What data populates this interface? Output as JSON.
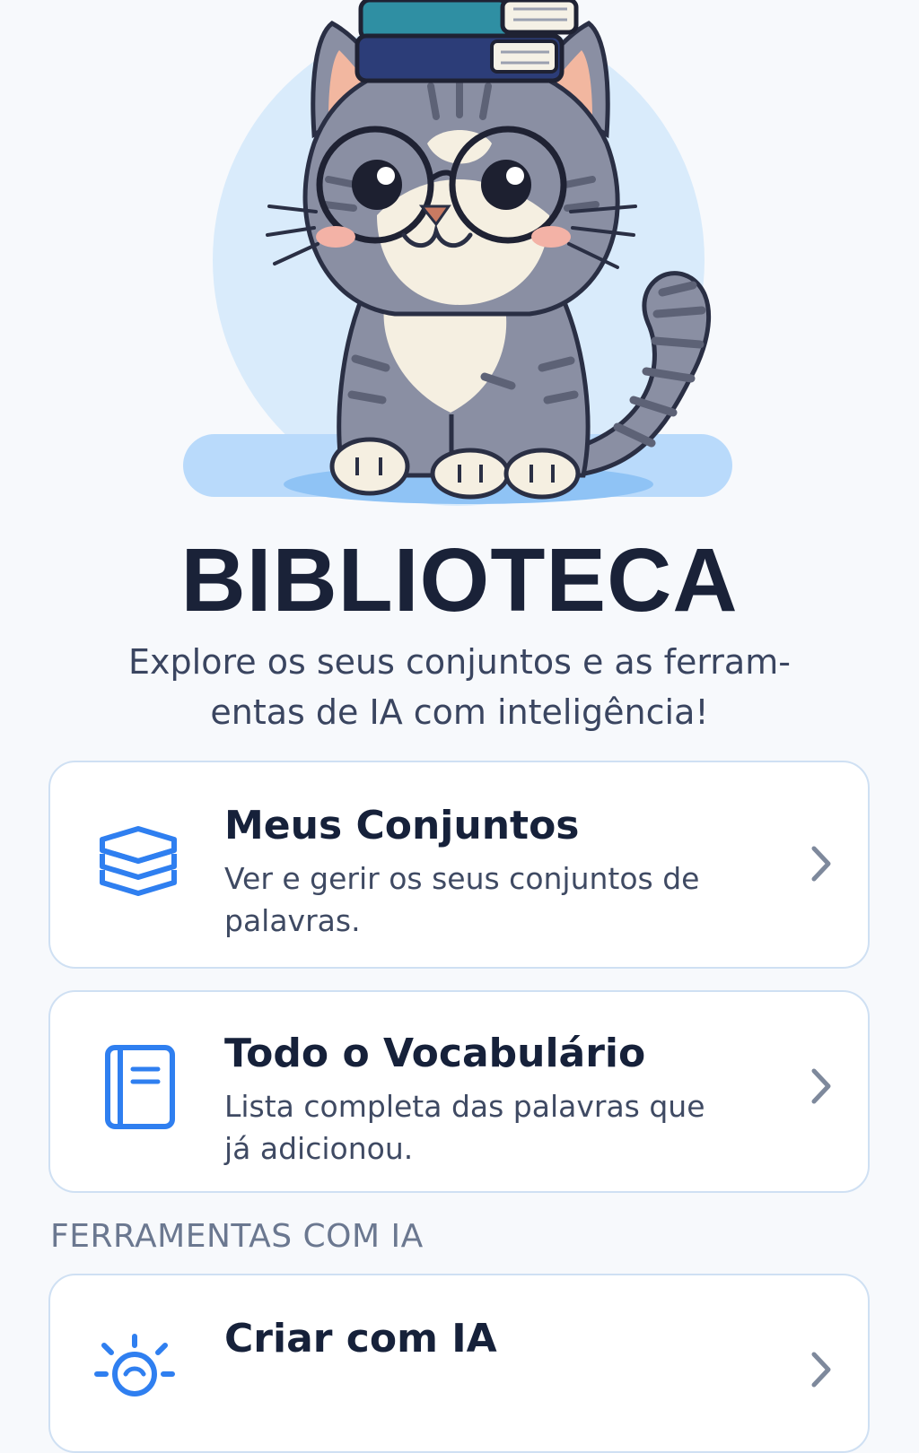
{
  "page": {
    "title": "BIBLIOTECA",
    "subtitle": "Explore os seus conjuntos e as ferram-\nentas de IA com inteligência!"
  },
  "illustration": {
    "name": "cat-reading-mascot",
    "description_icon": "cat-with-glasses-and-books-icon"
  },
  "cards": [
    {
      "title": "Meus Conjuntos",
      "description": "Ver e gerir os seus conjuntos de palavras.",
      "icon": "stack-layers-icon"
    },
    {
      "title": "Todo o Vocabulário",
      "description": "Lista completa das palavras que já adicionou.",
      "icon": "notebook-icon"
    }
  ],
  "ai_section": {
    "label": "FERRAMENTAS COM IA",
    "cards": [
      {
        "title": "Criar com IA",
        "icon": "lightbulb-sparkle-icon"
      }
    ]
  },
  "colors": {
    "accent": "#2f7ff0",
    "background": "#f7f9fc",
    "card_border": "#cfe0f3",
    "title": "#1a2238",
    "muted": "#6b7890"
  }
}
